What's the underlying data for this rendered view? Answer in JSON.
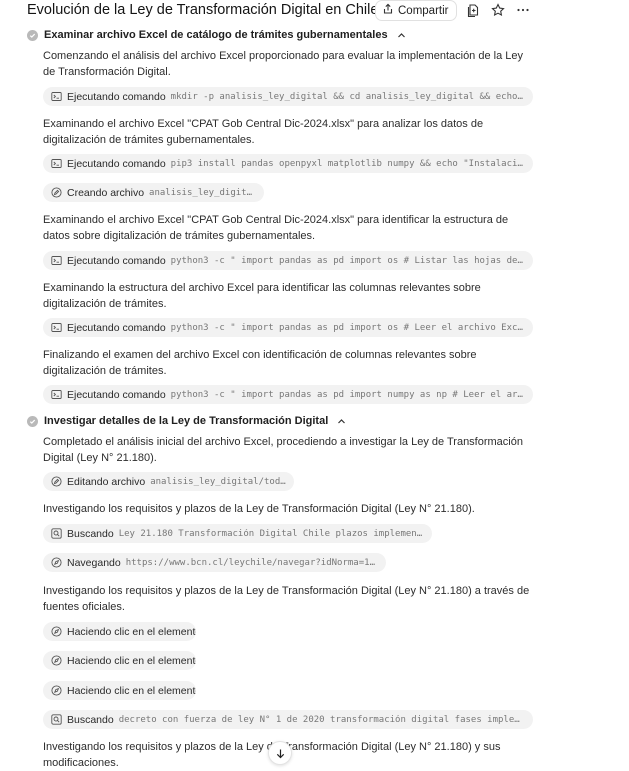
{
  "header": {
    "title": "Evolución de la Ley de Transformación Digital en Chile",
    "share_label": "Compartir"
  },
  "sections": [
    {
      "title": "Examinar archivo Excel de catálogo de trámites gubernamentales"
    },
    {
      "title": "Investigar detalles de la Ley de Transformación Digital"
    }
  ],
  "paragraphs": [
    "Comenzando el análisis del archivo Excel proporcionado para evaluar la implementación de la Ley de Transformación Digital.",
    "Examinando el archivo Excel \"CPAT Gob Central Dic-2024.xlsx\" para analizar los datos de digitalización de trámites gubernamentales.",
    "Examinando el archivo Excel \"CPAT Gob Central Dic-2024.xlsx\" para identificar la estructura de datos sobre digitalización de trámites gubernamentales.",
    "Examinando la estructura del archivo Excel para identificar las columnas relevantes sobre digitalización de trámites.",
    "Finalizando el examen del archivo Excel con identificación de columnas relevantes sobre digitalización de trámites.",
    "Completado el análisis inicial del archivo Excel, procediendo a investigar la Ley de Transformación Digital (Ley N° 21.180).",
    "Investigando los requisitos y plazos de la Ley de Transformación Digital (Ley N° 21.180).",
    "Investigando los requisitos y plazos de la Ley de Transformación Digital (Ley N° 21.180) a través de fuentes oficiales.",
    "Investigando los requisitos y plazos de la Ley de Transformación Digital (Ley N° 21.180) y sus modificaciones."
  ],
  "actions": [
    {
      "icon": "terminal-icon",
      "label": "Ejecutando comando",
      "detail": "mkdir -p analisis_ley_digital && cd analisis_ley_digital && echo \"Dire…"
    },
    {
      "icon": "terminal-icon",
      "label": "Ejecutando comando",
      "detail": "pip3 install pandas openpyxl matplotlib numpy && echo \"Instalación de …"
    },
    {
      "icon": "edit-icon",
      "label": "Creando archivo",
      "detail": "analisis_ley_digital/todo.md"
    },
    {
      "icon": "terminal-icon",
      "label": "Ejecutando comando",
      "detail": "python3 -c \" import pandas as pd import os # Listar las hojas del arch…"
    },
    {
      "icon": "terminal-icon",
      "label": "Ejecutando comando",
      "detail": "python3 -c \" import pandas as pd import os # Leer el archivo Excel con…"
    },
    {
      "icon": "terminal-icon",
      "label": "Ejecutando comando",
      "detail": "python3 -c \" import pandas as pd import numpy as np # Leer el archivo …"
    },
    {
      "icon": "edit-icon",
      "label": "Editando archivo",
      "detail": "analisis_ley_digital/todo.md"
    },
    {
      "icon": "search-icon",
      "label": "Buscando",
      "detail": "Ley 21.180 Transformación Digital Chile plazos implementación"
    },
    {
      "icon": "browser-icon",
      "label": "Navegando",
      "detail": "https://www.bcn.cl/leychile/navegar?idNorma=1138479"
    },
    {
      "icon": "browser-icon",
      "label": "Haciendo clic en el elemento",
      "detail": ""
    },
    {
      "icon": "browser-icon",
      "label": "Haciendo clic en el elemento",
      "detail": ""
    },
    {
      "icon": "browser-icon",
      "label": "Haciendo clic en el elemento",
      "detail": ""
    },
    {
      "icon": "search-icon",
      "label": "Buscando",
      "detail": "decreto con fuerza de ley N° 1 de 2020 transformación digital fases implementaci…"
    }
  ]
}
